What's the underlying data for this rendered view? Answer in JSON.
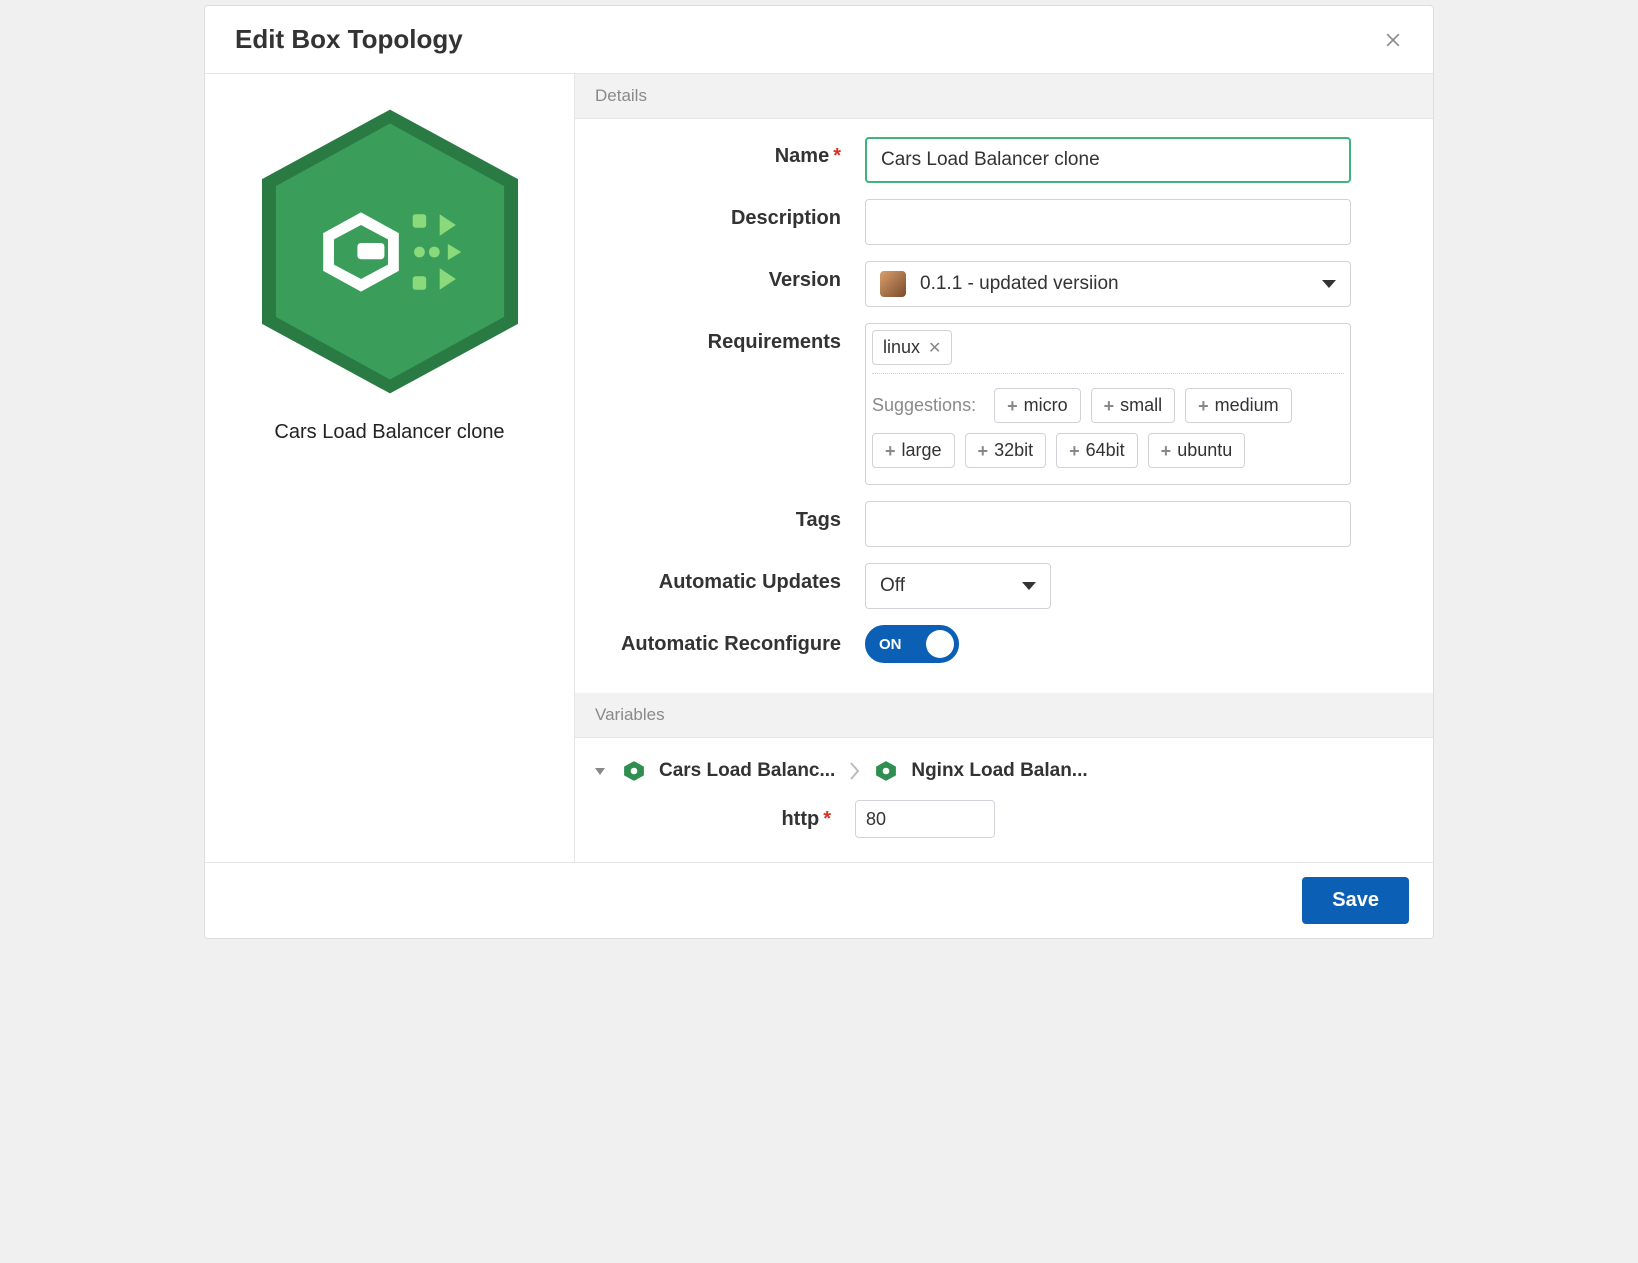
{
  "header": {
    "title": "Edit Box Topology"
  },
  "sidebar": {
    "title": "Cars Load Balancer clone"
  },
  "details": {
    "section_label": "Details",
    "labels": {
      "name": "Name",
      "description": "Description",
      "version": "Version",
      "requirements": "Requirements",
      "tags": "Tags",
      "auto_updates": "Automatic Updates",
      "auto_reconfigure": "Automatic Reconfigure"
    },
    "name_value": "Cars Load Balancer clone",
    "description_value": "",
    "version_value": "0.1.1 - updated versiion",
    "requirements": {
      "tags": [
        {
          "label": "linux"
        }
      ],
      "suggestions_label": "Suggestions:",
      "suggestions": [
        "micro",
        "small",
        "medium",
        "large",
        "32bit",
        "64bit",
        "ubuntu"
      ]
    },
    "tags_value": "",
    "auto_updates_value": "Off",
    "auto_reconfigure_on": "ON"
  },
  "variables": {
    "section_label": "Variables",
    "breadcrumb": [
      {
        "label": "Cars Load Balanc..."
      },
      {
        "label": "Nginx Load Balan..."
      }
    ],
    "fields": {
      "http_label": "http",
      "http_value": "80"
    }
  },
  "footer": {
    "save": "Save"
  },
  "colors": {
    "accent": "#0b5fb5",
    "hex_green": "#2f8f50",
    "focus_green": "#3eb37a"
  }
}
